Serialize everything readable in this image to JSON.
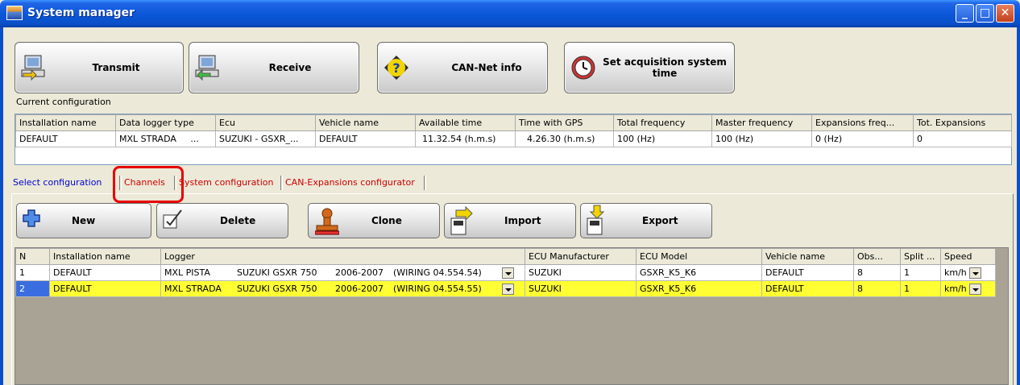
{
  "window": {
    "title": "System manager"
  },
  "toolbar": {
    "transmit": "Transmit",
    "receive": "Receive",
    "can_net_info": "CAN-Net info",
    "set_time": [
      "Set acquisition system",
      "time"
    ]
  },
  "current_config": {
    "label": "Current configuration",
    "columns": [
      "Installation name",
      "Data logger type",
      "Ecu",
      "Vehicle name",
      "Available time",
      "Time with GPS",
      "Total frequency",
      "Master frequency",
      "Expansions freq...",
      "Tot. Expansions"
    ],
    "row": [
      "DEFAULT",
      "MXL STRADA",
      "...",
      "SUZUKI - GSXR_...",
      "DEFAULT",
      "11.32.54 (h.m.s)",
      "4.26.30 (h.m.s)",
      "100 (Hz)",
      "100 (Hz)",
      "0 (Hz)",
      "0"
    ]
  },
  "tabs": [
    "Select configuration",
    "Channels",
    "System configuration",
    "CAN-Expansions configurator"
  ],
  "colors": {
    "tab_active": "#0000cc",
    "tab_other": "#cc0000",
    "selection": "#ffff33",
    "highlight": "#e60000"
  },
  "actions": {
    "new": "New",
    "delete": "Delete",
    "clone": "Clone",
    "import": "Import",
    "export": "Export"
  },
  "list": {
    "columns": [
      "N",
      "Installation name",
      "Logger",
      "ECU Manufacturer",
      "ECU Model",
      "Vehicle name",
      "Obs...",
      "Split ...",
      "Speed"
    ],
    "rows": [
      {
        "n": "1",
        "name": "DEFAULT",
        "logger": [
          "MXL PISTA",
          "SUZUKI GSXR 750",
          "2006-2007",
          "(WIRING 04.554.54)"
        ],
        "manufacturer": "SUZUKI",
        "model": "GSXR_K5_K6",
        "vehicle": "DEFAULT",
        "obs": "8",
        "split": "1",
        "speed": "km/h"
      },
      {
        "n": "2",
        "name": "DEFAULT",
        "logger": [
          "MXL STRADA",
          "SUZUKI GSXR 750",
          "2006-2007",
          "(WIRING 04.554.55)"
        ],
        "manufacturer": "SUZUKI",
        "model": "GSXR_K5_K6",
        "vehicle": "DEFAULT",
        "obs": "8",
        "split": "1",
        "speed": "km/h"
      }
    ]
  }
}
